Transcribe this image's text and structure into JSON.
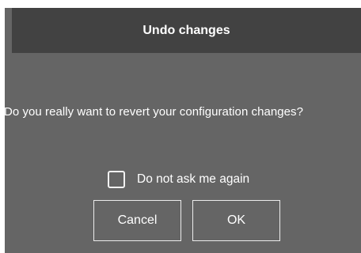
{
  "dialog": {
    "title": "Undo changes",
    "message": "Do you really want to revert your configuration changes?",
    "checkbox": {
      "label": "Do not ask me again",
      "checked": false
    },
    "buttons": {
      "cancel_label": "Cancel",
      "ok_label": "OK"
    }
  }
}
